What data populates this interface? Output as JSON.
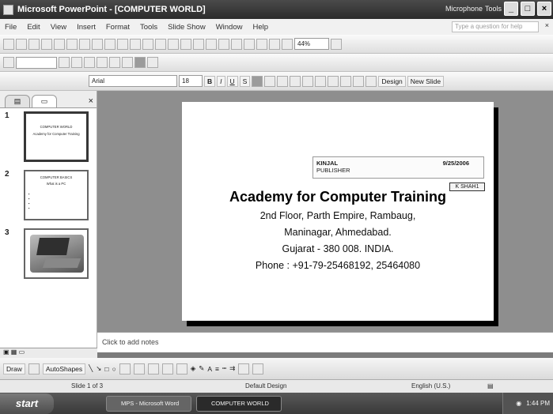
{
  "window": {
    "title": "Microsoft PowerPoint - [COMPUTER WORLD]",
    "microphone": "Microphone",
    "tools": "Tools"
  },
  "menu": {
    "items": [
      "File",
      "Edit",
      "View",
      "Insert",
      "Format",
      "Tools",
      "Slide Show",
      "Window",
      "Help"
    ],
    "ask_placeholder": "Type a question for help"
  },
  "toolbar": {
    "zoom": "44%",
    "font_name": "Arial",
    "font_size": "18",
    "design_label": "Design",
    "new_slide_label": "New Slide",
    "bold": "B",
    "italic": "I",
    "underline": "U",
    "shadow": "S"
  },
  "left_pane": {
    "tab_outline": "",
    "tab_slides": "",
    "thumbnails": [
      {
        "number": "1",
        "title": "COMPUTER WORLD",
        "text": "Academy for Computer Training"
      },
      {
        "number": "2",
        "title": "COMPUTER BASICS",
        "text": "What is a PC"
      },
      {
        "number": "3",
        "title": "",
        "text": ""
      }
    ]
  },
  "slide": {
    "title": "Academy for Computer Training",
    "lines": [
      "2nd Floor, Parth Empire, Rambaug,",
      "Maninagar, Ahmedabad.",
      "Gujarat - 380 008. INDIA.",
      "Phone : +91-79-25468192, 25464080"
    ],
    "comment": {
      "author": "KINJAL",
      "date": "9/25/2006",
      "text": "PUBLISHER",
      "marker": "K SHAH1"
    }
  },
  "notes": {
    "placeholder": "Click to add notes"
  },
  "drawbar": {
    "draw": "Draw",
    "autoshapes": "AutoShapes"
  },
  "status": {
    "slide": "Slide 1 of 3",
    "design": "Default Design",
    "language": "English (U.S.)"
  },
  "taskbar": {
    "start": "start",
    "tasks": [
      "MPS - Microsoft Word",
      "COMPUTER WORLD"
    ],
    "clock": "1:44 PM"
  }
}
